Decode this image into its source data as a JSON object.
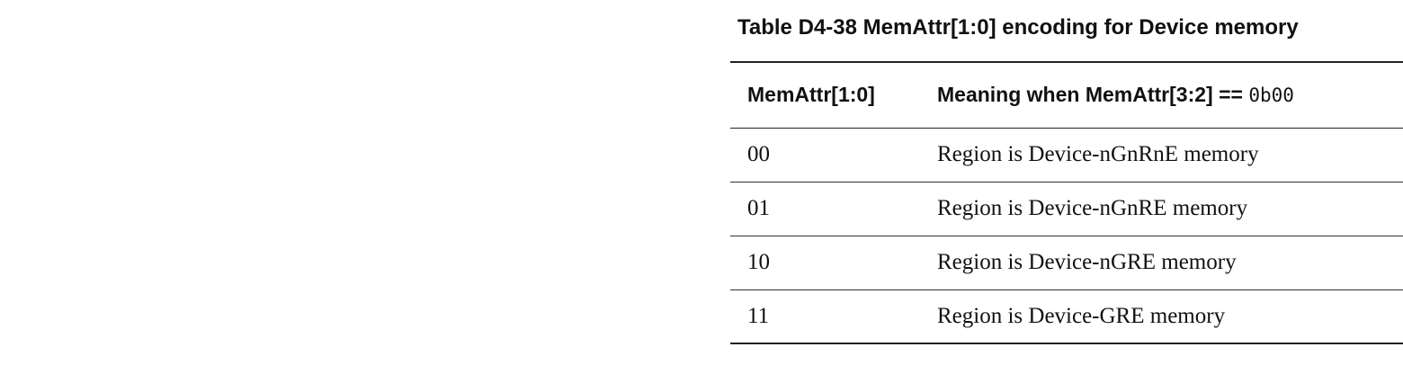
{
  "table": {
    "caption": "Table D4-38 MemAttr[1:0] encoding for Device memory",
    "headers": {
      "col1": "MemAttr[1:0]",
      "col2_prefix": "Meaning when MemAttr[3:2] == ",
      "col2_code": "0b00"
    },
    "rows": [
      {
        "value": "00",
        "meaning": "Region is Device-nGnRnE memory"
      },
      {
        "value": "01",
        "meaning": "Region is Device-nGnRE memory"
      },
      {
        "value": "10",
        "meaning": "Region is Device-nGRE memory"
      },
      {
        "value": "11",
        "meaning": "Region is Device-GRE memory"
      }
    ]
  }
}
